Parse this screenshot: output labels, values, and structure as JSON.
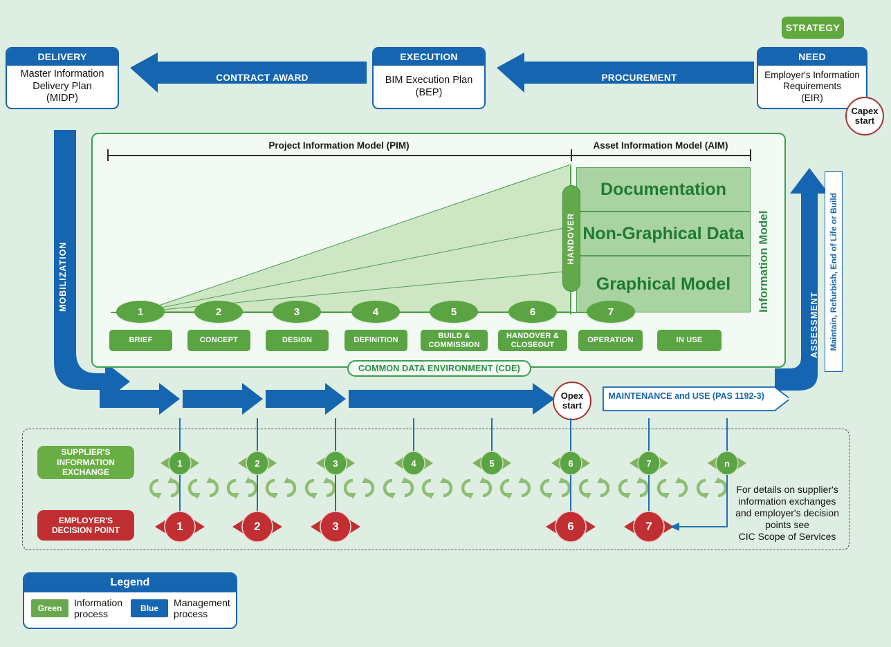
{
  "colors": {
    "background": "#dfeee3",
    "blue": "#1565b0",
    "green": "#5aa443",
    "light_green": "#a9d3a0",
    "red": "#bf2f32",
    "dark_red": "#a83232",
    "panel": "#f3faf4"
  },
  "top": {
    "strategy_label": "STRATEGY",
    "boxes": [
      {
        "header": "DELIVERY",
        "body": "Master Information\nDelivery Plan\n(MIDP)"
      },
      {
        "header": "EXECUTION",
        "body": "BIM Execution Plan\n(BEP)"
      },
      {
        "header": "NEED",
        "body": "Employer's Information\nRequirements\n(EIR)"
      }
    ],
    "arrows": [
      {
        "label": "CONTRACT AWARD"
      },
      {
        "label": "PROCUREMENT"
      }
    ],
    "capex_start": "Capex\nstart"
  },
  "panel": {
    "pim_title": "Project Information Model (PIM)",
    "aim_title": "Asset Information Model (AIM)",
    "bands": [
      "Documentation",
      "Non-Graphical Data",
      "Graphical Model"
    ],
    "handover_label": "HANDOVER",
    "information_model_label": "Information Model",
    "cde_label": "COMMON DATA ENVIRONMENT (CDE)",
    "stages": [
      {
        "num": "1",
        "label": "BRIEF"
      },
      {
        "num": "2",
        "label": "CONCEPT"
      },
      {
        "num": "3",
        "label": "DESIGN"
      },
      {
        "num": "4",
        "label": "DEFINITION"
      },
      {
        "num": "5",
        "label": "BUILD &\nCOMMISSION"
      },
      {
        "num": "6",
        "label": "HANDOVER &\nCLOSEOUT"
      },
      {
        "num": "7",
        "label": "OPERATION"
      },
      {
        "num": "",
        "label": "IN USE"
      }
    ]
  },
  "side": {
    "mobilization_label": "MOBILIZATION",
    "assessment_label": "ASSESSMENT",
    "maintain_label": "Maintain, Refurbish, End of Life or Build"
  },
  "timeline": {
    "opex_start": "Opex\nstart",
    "maintenance_label": "MAINTENANCE and USE (PAS 1192-3)"
  },
  "bottom": {
    "supplier_label": "SUPPLIER'S\nINFORMATION\nEXCHANGE",
    "decision_label": "EMPLOYER'S\nDECISION POINT",
    "supplier_points": [
      "1",
      "2",
      "3",
      "4",
      "5",
      "6",
      "7",
      "n"
    ],
    "decision_points": [
      "1",
      "2",
      "3",
      "",
      "",
      "6",
      "7",
      ""
    ],
    "note": "For details on supplier's\ninformation exchanges\nand employer's decision\npoints see\nCIC Scope of Services"
  },
  "legend": {
    "title": "Legend",
    "items": [
      {
        "swatch": "Green",
        "text": "Information\nprocess"
      },
      {
        "swatch": "Blue",
        "text": "Management\nprocess"
      }
    ]
  }
}
